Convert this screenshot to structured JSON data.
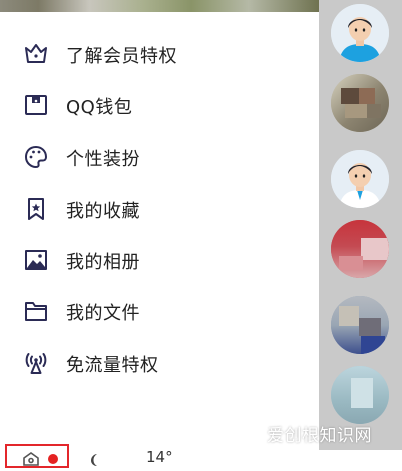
{
  "menu": {
    "items": [
      {
        "label": "了解会员特权",
        "icon": "crown-icon"
      },
      {
        "label": "QQ钱包",
        "icon": "wallet-icon"
      },
      {
        "label": "个性装扮",
        "icon": "palette-icon"
      },
      {
        "label": "我的收藏",
        "icon": "bookmark-star-icon"
      },
      {
        "label": "我的相册",
        "icon": "photo-album-icon"
      },
      {
        "label": "我的文件",
        "icon": "folder-icon"
      },
      {
        "label": "免流量特权",
        "icon": "signal-tower-icon"
      }
    ]
  },
  "bottom_bar": {
    "temperature": "14°",
    "icons": [
      "settings-icon",
      "notification-dot",
      "moon-icon"
    ]
  },
  "watermark": "爱创根知识网",
  "colors": {
    "accent_red": "#e3262b",
    "icon_color": "#2b2b55",
    "side_panel": "#c9c9c9"
  }
}
